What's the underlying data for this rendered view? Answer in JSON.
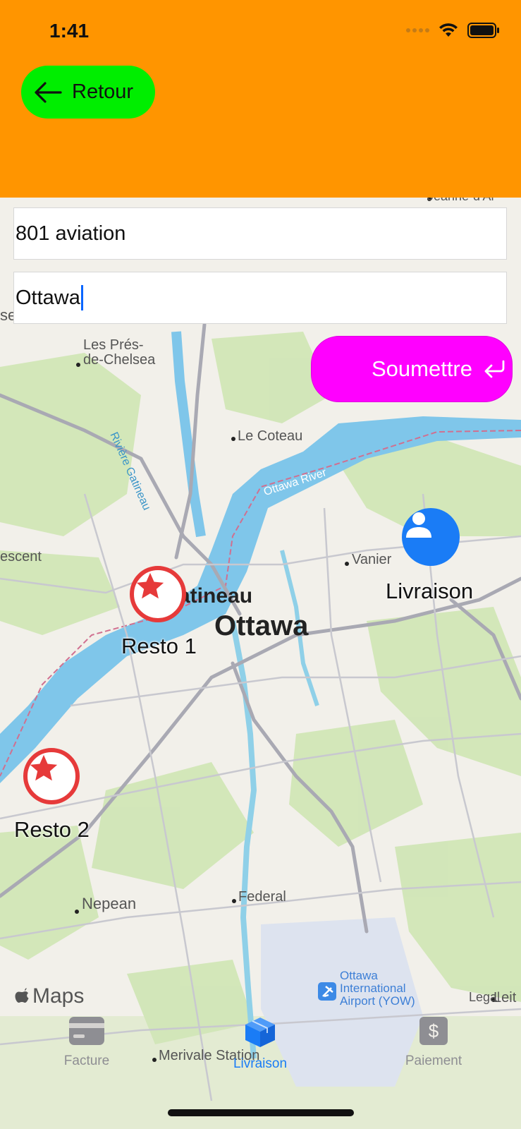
{
  "status_bar": {
    "time": "1:41"
  },
  "header": {
    "back_label": "Retour",
    "background": "#ff9500",
    "back_color": "#00ee00"
  },
  "form": {
    "address_value": "801 aviation",
    "city_value": "Ottawa",
    "submit_label": "Soumettre",
    "submit_color": "#ff00ff"
  },
  "map": {
    "labels": {
      "les_pres": "Les Prés-",
      "de_chelsea": "de-Chelsea",
      "riviere_gatineau": "Rivière Gatineau",
      "le_coteau": "Le Coteau",
      "ottawa_river": "Ottawa River",
      "vanier": "Vanier",
      "crescent": "escent",
      "gatineau": "atineau",
      "ottawa": "Ottawa",
      "nepean": "Nepean",
      "federal": "Federal",
      "airport_line1": "Ottawa",
      "airport_line2": "International",
      "airport_line3": "Airport (YOW)",
      "merivale": "Merivale Station",
      "top_right": "Jeanne-d'Ar",
      "edge_left": "se",
      "edge_right": "Leit"
    },
    "pins": {
      "resto1": "Resto 1",
      "resto2": "Resto 2",
      "livraison": "Livraison"
    },
    "attribution": "Maps",
    "legal": "Legal"
  },
  "tabs": [
    {
      "label": "Facture",
      "icon": "credit-card-icon",
      "active": false
    },
    {
      "label": "Livraison",
      "icon": "shipping-box-icon",
      "active": true
    },
    {
      "label": "Paiement",
      "icon": "dollar-sign-icon",
      "active": false
    }
  ]
}
